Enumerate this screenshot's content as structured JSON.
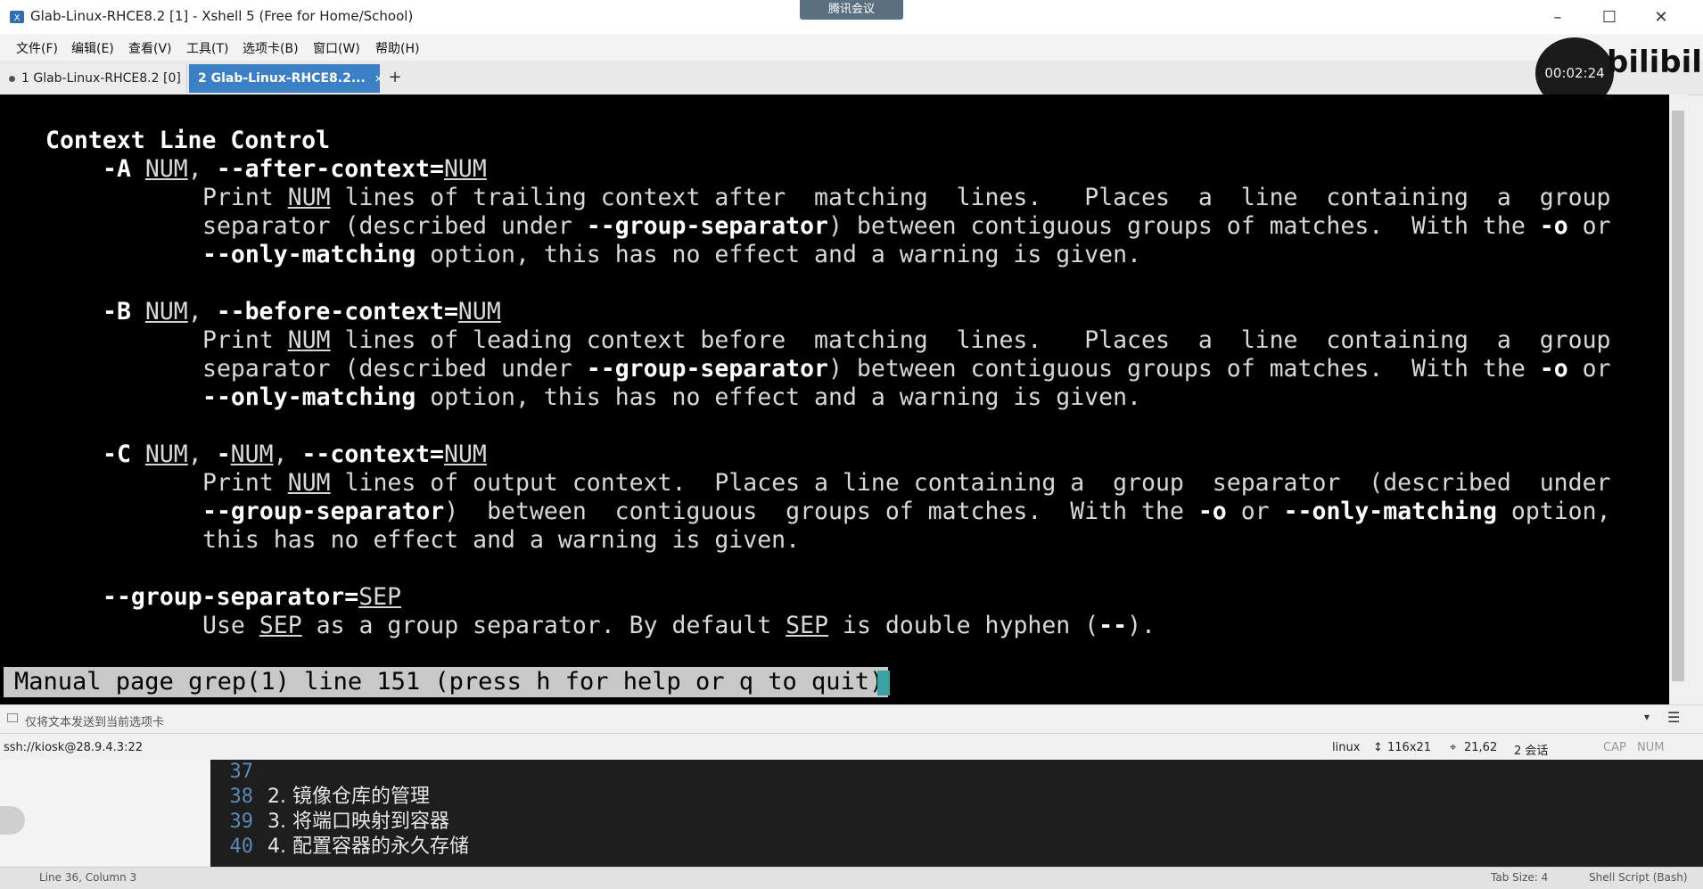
{
  "window": {
    "title": "Glab-Linux-RHCE8.2 [1] - Xshell 5 (Free for Home/School)",
    "meeting_badge": "腾讯会议",
    "minimize": "–",
    "maximize": "☐",
    "close": "✕"
  },
  "menu": [
    "文件(F)",
    "编辑(E)",
    "查看(V)",
    "工具(T)",
    "选项卡(B)",
    "窗口(W)",
    "帮助(H)"
  ],
  "tabs": [
    {
      "label": "1 Glab-Linux-RHCE8.2 [0]"
    },
    {
      "label": "2 Glab-Linux-RHCE8.2...",
      "close": "×"
    }
  ],
  "new_tab": "+",
  "overlay": {
    "timer": "00:02:24",
    "logo": "bilibili"
  },
  "terminal": {
    "section_title": "Context Line Control",
    "a_opt": {
      "flag": "-A",
      "arg": "NUM",
      "sep": ", ",
      "long": "--after-context=",
      "long_arg": "NUM"
    },
    "a_l1": {
      "p1": "Print ",
      "num": "NUM",
      "p2": " lines of trailing context after  matching  lines.   Places  a  line  containing  a  group"
    },
    "a_l2": {
      "p1": "separator (described under ",
      "gs": "--group-separator",
      "p2": ") between contiguous groups of matches.  With the ",
      "o": "-o",
      "p3": " or"
    },
    "a_l3": {
      "om": "--only-matching",
      "p1": " option, this has no effect and a warning is given."
    },
    "b_opt": {
      "flag": "-B",
      "arg": "NUM",
      "sep": ", ",
      "long": "--before-context=",
      "long_arg": "NUM"
    },
    "b_l1": {
      "p1": "Print ",
      "num": "NUM",
      "p2": " lines of leading context before  matching  lines.   Places  a  line  containing  a  group"
    },
    "b_l2": {
      "p1": "separator (described under ",
      "gs": "--group-separator",
      "p2": ") between contiguous groups of matches.  With the ",
      "o": "-o",
      "p3": " or"
    },
    "b_l3": {
      "om": "--only-matching",
      "p1": " option, this has no effect and a warning is given."
    },
    "c_opt": {
      "flag": "-C",
      "arg": "NUM",
      "sep1": ", ",
      "dash": "-",
      "arg2": "NUM",
      "sep2": ", ",
      "long": "--context=",
      "long_arg": "NUM"
    },
    "c_l1": {
      "p1": "Print ",
      "num": "NUM",
      "p2": " lines of output context.  Places a line containing a  group  separator  (described  under"
    },
    "c_l2": {
      "gs": "--group-separator",
      "p1": ")  between  contiguous  groups of matches.  With the ",
      "o": "-o",
      "p2": " or ",
      "om": "--only-matching",
      "p3": " option,"
    },
    "c_l3": "this has no effect and a warning is given.",
    "gs_opt": {
      "long": "--group-separator=",
      "arg": "SEP"
    },
    "gs_l1": {
      "p1": "Use ",
      "sep": "SEP",
      "p2": " as a group separator. By default ",
      "sep2": "SEP",
      "p3": " is double hyphen (",
      "dd": "--",
      "p4": ")."
    },
    "status": "Manual page grep(1) line 151 (press h for help or q to quit)"
  },
  "compose_bar": {
    "text": "仅将文本发送到当前选项卡"
  },
  "statusbar": {
    "connection": "ssh://kiosk@28.9.4.3:22",
    "os": "linux",
    "size": "116x21",
    "cursor": "21,62",
    "sessions": "2 会话",
    "caps": "CAP",
    "num": "NUM"
  },
  "editor": {
    "lines": [
      {
        "n": "37",
        "text": ""
      },
      {
        "n": "38",
        "text": "2. 镜像仓库的管理"
      },
      {
        "n": "39",
        "text": "3. 将端口映射到容器"
      },
      {
        "n": "40",
        "text": "4. 配置容器的永久存储"
      }
    ],
    "status_left": "Line 36, Column 3",
    "tab_size": "Tab Size: 4",
    "syntax": "Shell Script (Bash)"
  }
}
